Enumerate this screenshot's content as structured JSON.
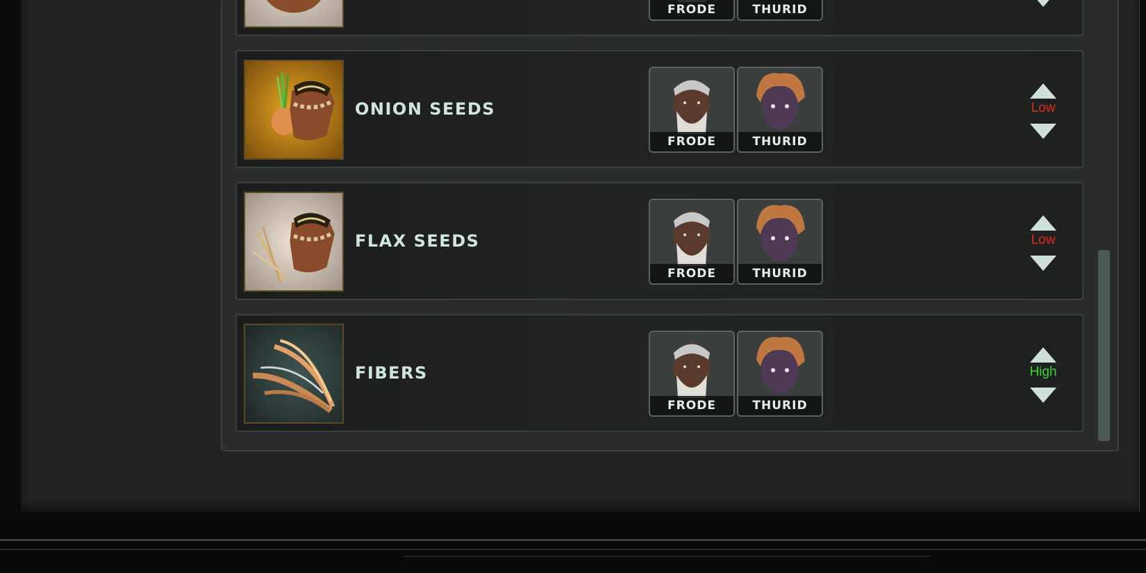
{
  "rows": [
    {
      "item": "",
      "icon": "seed-bag-icon",
      "workers": [
        "FRODE",
        "THURID"
      ],
      "priority": "",
      "priority_color": "#e23b2b",
      "partial": true
    },
    {
      "item": "ONION SEEDS",
      "icon": "onion-seeds-icon",
      "workers": [
        "FRODE",
        "THURID"
      ],
      "priority": "Low",
      "priority_color": "#e02a1d"
    },
    {
      "item": "FLAX SEEDS",
      "icon": "flax-seeds-icon",
      "workers": [
        "FRODE",
        "THURID"
      ],
      "priority": "Low",
      "priority_color": "#e02a1d"
    },
    {
      "item": "FIBERS",
      "icon": "fibers-icon",
      "workers": [
        "FRODE",
        "THURID"
      ],
      "priority": "High",
      "priority_color": "#3fd42f"
    }
  ],
  "colors": {
    "text": "#cfe6df",
    "panel": "#2b2d2c",
    "low": "#e02a1d",
    "high": "#3fd42f"
  }
}
